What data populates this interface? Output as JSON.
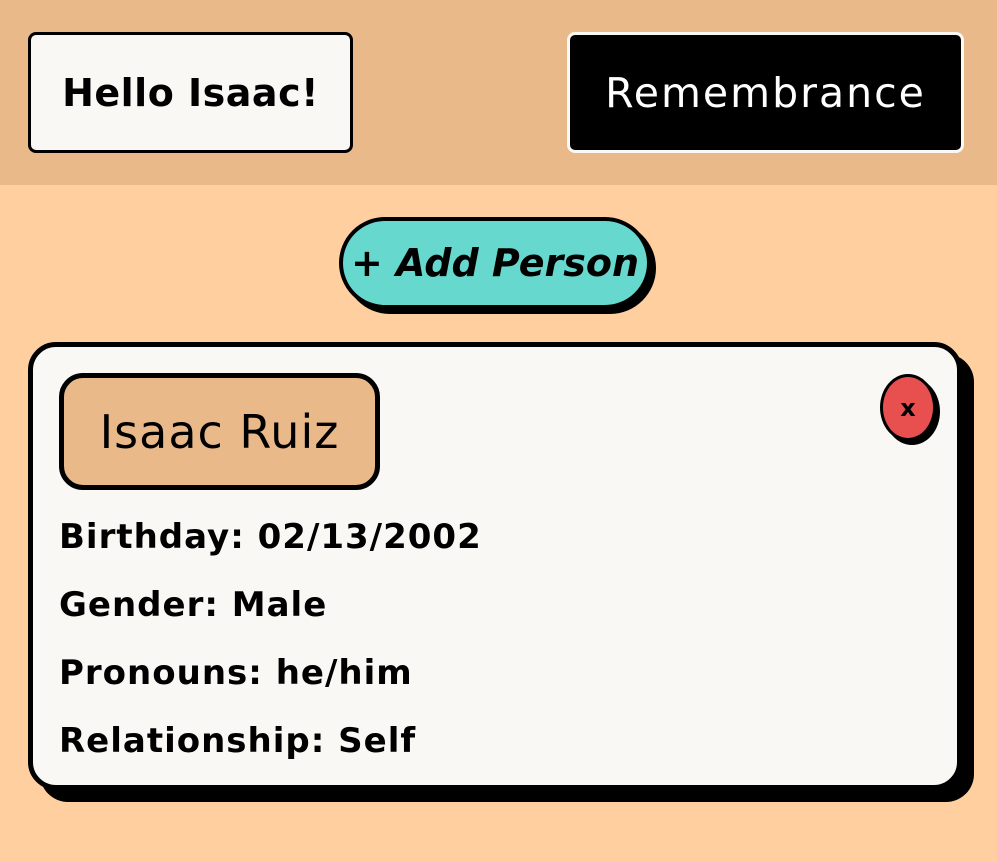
{
  "header": {
    "greeting": "Hello Isaac!",
    "brand": "Remembrance"
  },
  "actions": {
    "add_person_label": "+ Add Person"
  },
  "person_card": {
    "name": "Isaac Ruiz",
    "delete_label": "x",
    "fields": [
      {
        "text": "Birthday: 02/13/2002"
      },
      {
        "text": "Gender: Male"
      },
      {
        "text": "Pronouns: he/him"
      },
      {
        "text": "Relationship: Self"
      }
    ]
  },
  "colors": {
    "page_background": "#FFCFA0",
    "header_background": "#E9B98A",
    "add_button": "#66D8CE",
    "delete_button": "#E85050",
    "card_background": "#FAF8F4"
  }
}
